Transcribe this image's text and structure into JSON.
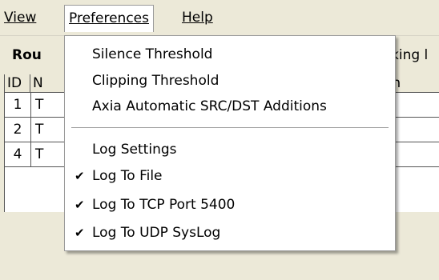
{
  "menubar": {
    "view_label": "View",
    "preferences_label": "Preferences",
    "help_label": "Help"
  },
  "panel": {
    "group_left_label": "Rou",
    "group_right_label": "king l"
  },
  "table": {
    "headers": [
      "ID",
      "N",
      "on"
    ],
    "rows": [
      {
        "id": "1",
        "name": "T"
      },
      {
        "id": "2",
        "name": "T"
      },
      {
        "id": "4",
        "name": "T"
      }
    ]
  },
  "preferences_menu": {
    "items": [
      {
        "label": "Silence Threshold",
        "checked": false
      },
      {
        "label": "Clipping Threshold",
        "checked": false
      },
      {
        "label": "Axia Automatic SRC/DST Additions",
        "checked": false
      },
      {
        "label": "Log Settings",
        "checked": false
      },
      {
        "label": "Log To File",
        "checked": true
      },
      {
        "label": "Log To TCP Port 5400",
        "checked": true
      },
      {
        "label": "Log To UDP SysLog",
        "checked": true
      }
    ],
    "check_glyph": "✔"
  }
}
